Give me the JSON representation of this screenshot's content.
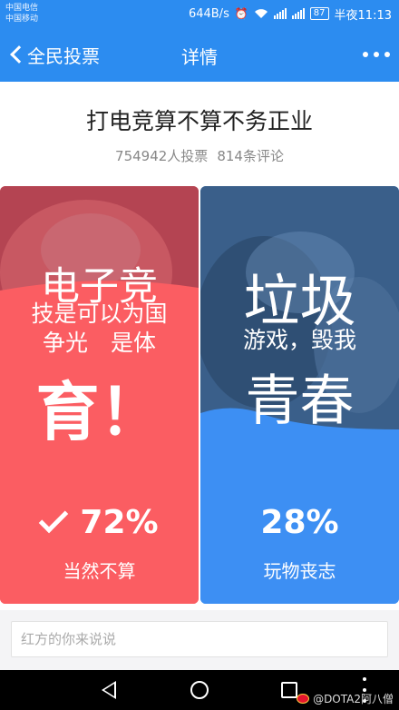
{
  "status_bar": {
    "carrier1": "中国电信",
    "carrier2": "中国移动",
    "speed": "644B/s",
    "battery": "87",
    "time": "半夜11:13"
  },
  "navbar": {
    "back_label": "全民投票",
    "title": "详情",
    "more_icon": "more-dots-icon"
  },
  "poll": {
    "question": "打电竞算不算不务正业",
    "voters": "754942人投票",
    "comments": "814条评论"
  },
  "options": {
    "left": {
      "slogan_line1": "电子竞",
      "slogan_line2": "技是可以为国",
      "slogan_line3": "争光　是体",
      "slogan_line4": "育！",
      "percent": "72%",
      "percent_value": 72,
      "label": "当然不算",
      "selected": true,
      "color": "#fb5d62",
      "icon": "check-icon"
    },
    "right": {
      "slogan_line1": "垃圾",
      "slogan_line2": "游戏，毁我",
      "slogan_line3": "青春",
      "percent": "28%",
      "percent_value": 28,
      "label": "玩物丧志",
      "color": "#3d8ff3"
    }
  },
  "comment": {
    "placeholder": "红方的你来说说"
  },
  "system_nav": {
    "watermark": "@DOTA2阿八僧"
  },
  "colors": {
    "accent": "#2c8cf0",
    "red": "#fb5d62",
    "blue": "#3d8ff3"
  }
}
